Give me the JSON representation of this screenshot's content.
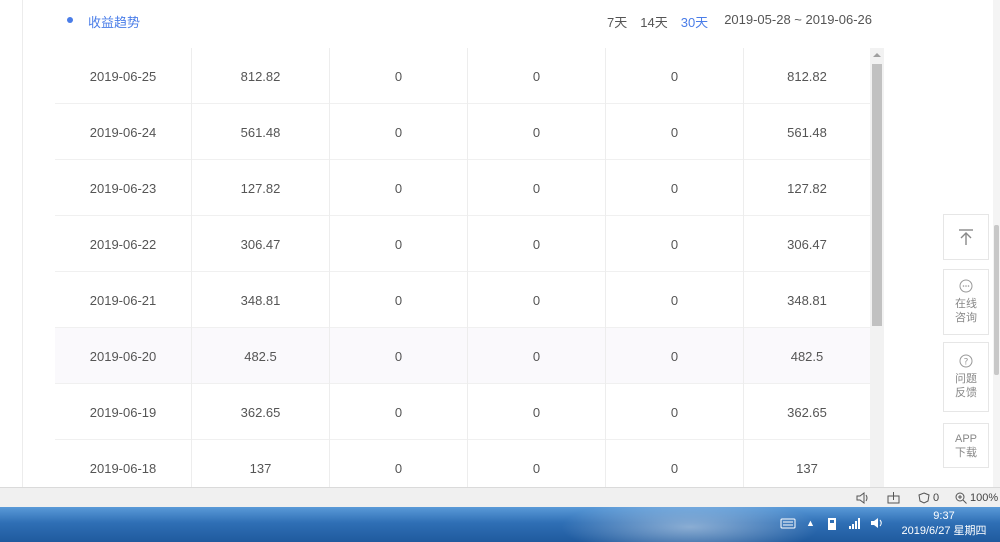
{
  "header": {
    "title": "收益趋势",
    "ranges": [
      "7天",
      "14天",
      "30天"
    ],
    "active_range_index": 2,
    "date_range": "2019-05-28 ~ 2019-06-26"
  },
  "table": {
    "rows": [
      [
        "2019-06-25",
        "812.82",
        "0",
        "0",
        "0",
        "812.82"
      ],
      [
        "2019-06-24",
        "561.48",
        "0",
        "0",
        "0",
        "561.48"
      ],
      [
        "2019-06-23",
        "127.82",
        "0",
        "0",
        "0",
        "127.82"
      ],
      [
        "2019-06-22",
        "306.47",
        "0",
        "0",
        "0",
        "306.47"
      ],
      [
        "2019-06-21",
        "348.81",
        "0",
        "0",
        "0",
        "348.81"
      ],
      [
        "2019-06-20",
        "482.5",
        "0",
        "0",
        "0",
        "482.5"
      ],
      [
        "2019-06-19",
        "362.65",
        "0",
        "0",
        "0",
        "362.65"
      ],
      [
        "2019-06-18",
        "137",
        "0",
        "0",
        "0",
        "137"
      ]
    ]
  },
  "side_panel": {
    "back_to_top_icon": "arrow-up-to-line-icon",
    "chat_label": [
      "在线",
      "咨询"
    ],
    "feedback_label": [
      "问题",
      "反馈"
    ],
    "app_label": [
      "APP",
      "下载"
    ]
  },
  "statusbar": {
    "blocked_count": "0",
    "zoom": "100%"
  },
  "taskbar": {
    "time": "9:37",
    "date": "2019/6/27 星期四"
  },
  "colors": {
    "accent": "#4a7de8",
    "taskbar": "#2f6fb5"
  }
}
